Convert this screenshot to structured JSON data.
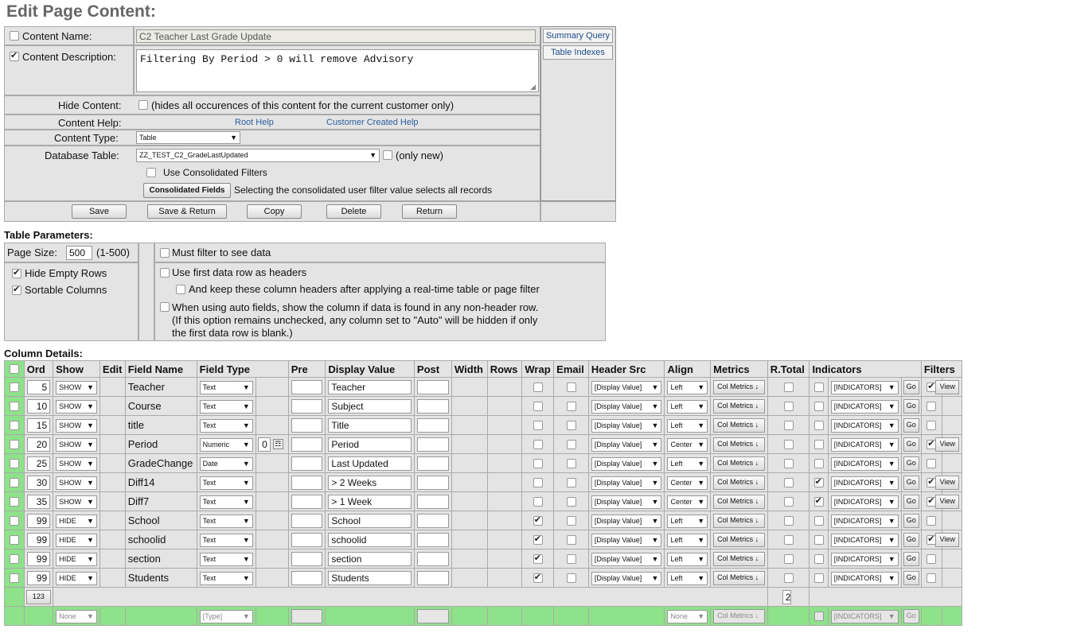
{
  "page_title": "Edit Page Content:",
  "content": {
    "name_label": "Content Name:",
    "name_value": "C2 Teacher Last Grade Update",
    "desc_label": "Content Description:",
    "desc_value": "Filtering By Period > 0 will remove Advisory",
    "hide_label": "Hide Content:",
    "hide_note": "(hides all occurences of this content for the current customer only)",
    "help_label": "Content Help:",
    "root_help": "Root Help",
    "customer_help": "Customer Created Help",
    "type_label": "Content Type:",
    "type_value": "Table",
    "db_label": "Database Table:",
    "db_value": "ZZ_TEST_C2_GradeLastUpdated",
    "only_new": "(only new)",
    "consolidated_filters": "Use Consolidated Filters",
    "consolidated_fields_btn": "Consolidated Fields",
    "consolidated_note": "Selecting the consolidated user filter value selects all records",
    "summary_query": "Summary Query",
    "table_indexes": "Table Indexes"
  },
  "actions": [
    "Save",
    "Save & Return",
    "Copy",
    "Delete",
    "Return"
  ],
  "table_params": {
    "heading": "Table Parameters:",
    "page_size_label": "Page Size:",
    "page_size": "500",
    "page_size_range": "(1-500)",
    "hide_empty_rows": "Hide Empty Rows",
    "sortable_columns": "Sortable Columns",
    "must_filter": "Must filter to see data",
    "first_row_headers": "Use first data row as headers",
    "keep_headers": "And keep these column headers after applying a real-time table or page filter",
    "auto_fields_1": "When using auto fields, show the column if data is found in any non-header row.",
    "auto_fields_2": "(If this option remains unchecked, any column set to \"Auto\" will be hidden if only",
    "auto_fields_3": "the first data row is blank.)"
  },
  "column_details": {
    "heading": "Column Details:",
    "headers": [
      "Ord",
      "Show",
      "Edit",
      "Field Name",
      "Field Type",
      "Pre",
      "Display Value",
      "Post",
      "Width",
      "Rows",
      "Wrap",
      "Email",
      "Header Src",
      "Align",
      "Metrics",
      "R.Total",
      "Indicators",
      "Filters"
    ],
    "header_src": "[Display Value]",
    "metrics_btn": "Col Metrics ↓",
    "indicators": "[INDICATORS]",
    "go": "Go",
    "view": "View",
    "rows": [
      {
        "ord": "5",
        "show": "SHOW",
        "field": "Teacher",
        "type": "Text",
        "display": "Teacher",
        "align": "Left",
        "wrap": false,
        "ind_on": false,
        "filter_on": true,
        "filter": "Real-Time",
        "numeric_extra": ""
      },
      {
        "ord": "10",
        "show": "SHOW",
        "field": "Course",
        "type": "Text",
        "display": "Subject",
        "align": "Left",
        "wrap": false,
        "ind_on": false,
        "filter_on": false,
        "filter": "",
        "numeric_extra": ""
      },
      {
        "ord": "15",
        "show": "SHOW",
        "field": "title",
        "type": "Text",
        "display": "Title",
        "align": "Left",
        "wrap": false,
        "ind_on": false,
        "filter_on": false,
        "filter": "",
        "numeric_extra": ""
      },
      {
        "ord": "20",
        "show": "SHOW",
        "field": "Period",
        "type": "Numeric",
        "display": "Period",
        "align": "Center",
        "wrap": false,
        "ind_on": false,
        "filter_on": true,
        "filter": "Real-Time",
        "numeric_extra": "0"
      },
      {
        "ord": "25",
        "show": "SHOW",
        "field": "GradeChange",
        "type": "Date",
        "display": "Last Updated",
        "align": "Left",
        "wrap": false,
        "ind_on": false,
        "filter_on": false,
        "filter": "",
        "numeric_extra": ""
      },
      {
        "ord": "30",
        "show": "SHOW",
        "field": "Diff14",
        "type": "Text",
        "display": "> 2 Weeks",
        "align": "Center",
        "wrap": false,
        "ind_on": true,
        "filter_on": true,
        "filter": "Real-Time",
        "numeric_extra": ""
      },
      {
        "ord": "35",
        "show": "SHOW",
        "field": "Diff7",
        "type": "Text",
        "display": "> 1 Week",
        "align": "Center",
        "wrap": false,
        "ind_on": true,
        "filter_on": true,
        "filter": "Real-Time",
        "numeric_extra": ""
      },
      {
        "ord": "99",
        "show": "HIDE",
        "field": "School",
        "type": "Text",
        "display": "School",
        "align": "Left",
        "wrap": true,
        "ind_on": false,
        "filter_on": false,
        "filter": "",
        "numeric_extra": ""
      },
      {
        "ord": "99",
        "show": "HIDE",
        "field": "schoolid",
        "type": "Text",
        "display": "schoolid",
        "align": "Left",
        "wrap": true,
        "ind_on": false,
        "filter_on": true,
        "filter": "User Defined",
        "numeric_extra": ""
      },
      {
        "ord": "99",
        "show": "HIDE",
        "field": "section",
        "type": "Text",
        "display": "section",
        "align": "Left",
        "wrap": true,
        "ind_on": false,
        "filter_on": false,
        "filter": "",
        "numeric_extra": ""
      },
      {
        "ord": "99",
        "show": "HIDE",
        "field": "Students",
        "type": "Text",
        "display": "Students",
        "align": "Left",
        "wrap": true,
        "ind_on": false,
        "filter_on": false,
        "filter": "",
        "numeric_extra": ""
      }
    ],
    "renumber_btn": "123",
    "rtotal_value": "2",
    "new_row": {
      "show": "None",
      "type": "[Type]",
      "align": "None"
    }
  }
}
